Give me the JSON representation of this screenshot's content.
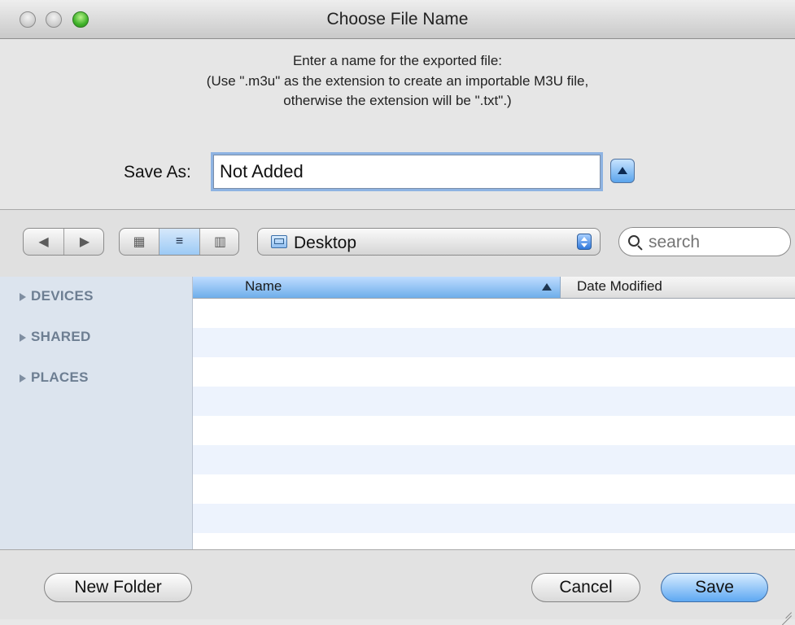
{
  "window": {
    "title": "Choose File Name"
  },
  "message": {
    "line1": "Enter a name for the exported file:",
    "line2": "(Use \".m3u\" as the extension to create an importable M3U file,",
    "line3": "otherwise the extension will be \".txt\".)"
  },
  "save_as": {
    "label": "Save As:",
    "value": "Not Added"
  },
  "toolbar": {
    "back_glyph": "◀",
    "forward_glyph": "▶",
    "icon_view_glyph": "▦",
    "list_view_glyph": "≡",
    "column_view_glyph": "▥",
    "location": "Desktop",
    "search_placeholder": "search"
  },
  "sidebar": {
    "groups": [
      {
        "label": "DEVICES"
      },
      {
        "label": "SHARED"
      },
      {
        "label": "PLACES"
      }
    ]
  },
  "file_list": {
    "columns": [
      {
        "label": "Name"
      },
      {
        "label": "Date Modified"
      }
    ],
    "rows": []
  },
  "buttons": {
    "new_folder": "New Folder",
    "cancel": "Cancel",
    "save": "Save"
  },
  "colors": {
    "accent": "#5ea8f2",
    "sidebar_bg": "#dce4ee",
    "row_alt": "#edf3fd"
  }
}
